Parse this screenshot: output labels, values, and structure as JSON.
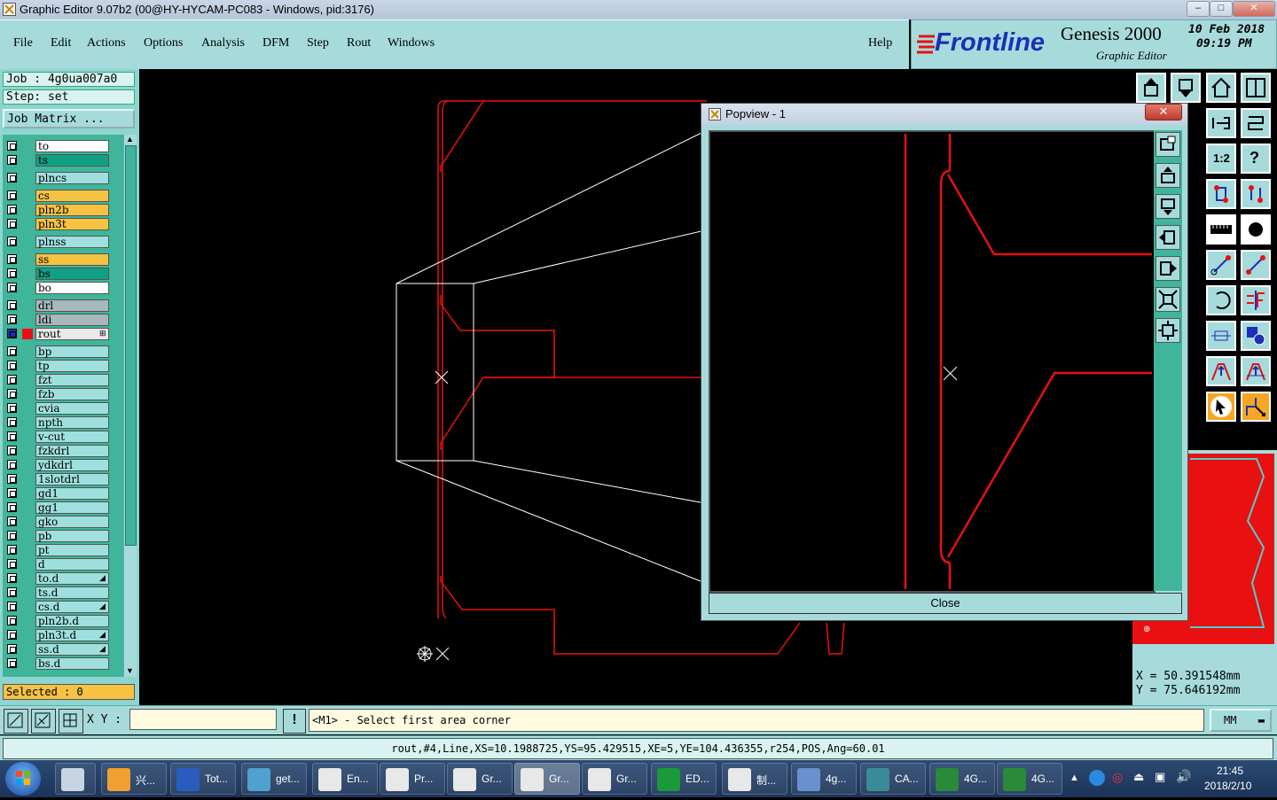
{
  "window": {
    "title": "Graphic Editor 9.07b2 (00@HY-HYCAM-PC083 - Windows, pid:3176)",
    "min": "–",
    "max": "□",
    "close": "✕"
  },
  "menu": [
    "File",
    "Edit",
    "Actions",
    "Options",
    "Analysis",
    "DFM",
    "Step",
    "Rout",
    "Windows"
  ],
  "help": "Help",
  "brand": {
    "logo": "Frontline",
    "product": "Genesis 2000",
    "subtitle": "Graphic Editor",
    "date": "10 Feb 2018",
    "time": "09:19 PM"
  },
  "job": {
    "job_label": "Job : 4g0ua007a0",
    "step_label": "Step: set",
    "matrix_button": "Job Matrix ..."
  },
  "layers": [
    {
      "name": "to",
      "color": "#ffffff"
    },
    {
      "name": "ts",
      "color": "#12a085"
    },
    {
      "name": "plncs",
      "color": "#9fe0de"
    },
    {
      "name": "cs",
      "color": "#f5c242"
    },
    {
      "name": "pln2b",
      "color": "#f5c242"
    },
    {
      "name": "pln3t",
      "color": "#f5c242"
    },
    {
      "name": "plnss",
      "color": "#9fe0de"
    },
    {
      "name": "ss",
      "color": "#f5c242"
    },
    {
      "name": "bs",
      "color": "#12a085"
    },
    {
      "name": "bo",
      "color": "#ffffff"
    },
    {
      "name": "drl",
      "color": "#a8b8bc"
    },
    {
      "name": "ldi",
      "color": "#a8b8bc"
    },
    {
      "name": "rout",
      "color": "#e8e8e8",
      "mark": "⊞"
    },
    {
      "name": "bp",
      "color": "#9fe0de"
    },
    {
      "name": "tp",
      "color": "#9fe0de"
    },
    {
      "name": "fzt",
      "color": "#9fe0de"
    },
    {
      "name": "fzb",
      "color": "#9fe0de"
    },
    {
      "name": "cvia",
      "color": "#9fe0de"
    },
    {
      "name": "npth",
      "color": "#9fe0de"
    },
    {
      "name": "v-cut",
      "color": "#9fe0de"
    },
    {
      "name": "fzkdrl",
      "color": "#9fe0de"
    },
    {
      "name": "ydkdrl",
      "color": "#9fe0de"
    },
    {
      "name": "1slotdrl",
      "color": "#9fe0de"
    },
    {
      "name": "gd1",
      "color": "#9fe0de"
    },
    {
      "name": "gg1",
      "color": "#9fe0de"
    },
    {
      "name": "gko",
      "color": "#9fe0de"
    },
    {
      "name": "pb",
      "color": "#9fe0de"
    },
    {
      "name": "pt",
      "color": "#9fe0de"
    },
    {
      "name": "d",
      "color": "#9fe0de"
    },
    {
      "name": "to.d",
      "color": "#9fe0de",
      "mark": "◢"
    },
    {
      "name": "ts.d",
      "color": "#9fe0de"
    },
    {
      "name": "cs.d",
      "color": "#9fe0de",
      "mark": "◢"
    },
    {
      "name": "pln2b.d",
      "color": "#9fe0de"
    },
    {
      "name": "pln3t.d",
      "color": "#9fe0de",
      "mark": "◢"
    },
    {
      "name": "ss.d",
      "color": "#9fe0de",
      "mark": "◢"
    },
    {
      "name": "bs.d",
      "color": "#9fe0de"
    }
  ],
  "selected": "Selected : 0",
  "popview": {
    "title": "Popview - 1",
    "close_x": "✕",
    "close_button": "Close"
  },
  "coords": {
    "x": "X = 50.391548mm",
    "y": "Y = 75.646192mm"
  },
  "cmd": {
    "xy_label": "X Y :",
    "input_value": "",
    "prompt": "<M1> - Select first area corner",
    "units": "MM"
  },
  "status": "rout,#4,Line,XS=10.1988725,YS=95.429515,XE=5,YE=104.436355,r254,POS,Ang=60.01",
  "taskbar": {
    "items": [
      "兴...",
      "Tot...",
      "get...",
      "En...",
      "Pr...",
      "Gr...",
      "Gr...",
      "Gr...",
      "ED...",
      "制...",
      "4g...",
      "CA...",
      "4G...",
      "4G..."
    ],
    "clock_time": "21:45",
    "clock_date": "2018/2/10"
  },
  "colors": {
    "panel": "#a7dbdb",
    "accent_red": "#e81010",
    "teal": "#3fb59a"
  }
}
